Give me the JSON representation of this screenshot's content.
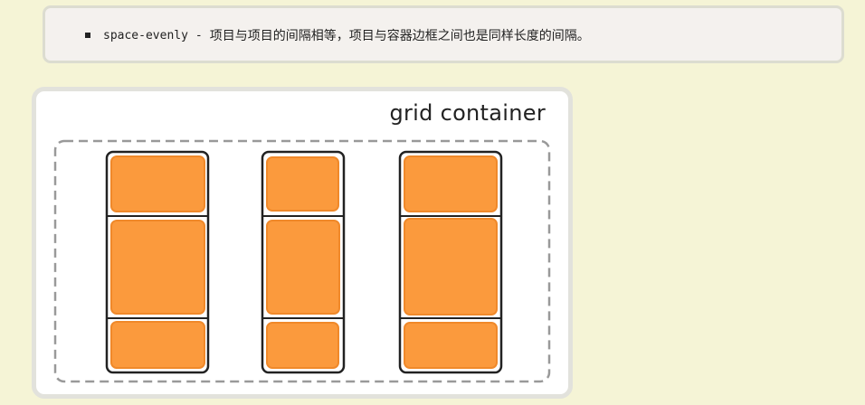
{
  "note": {
    "property": "space-evenly",
    "separator": "-",
    "description": "项目与项目的间隔相等，项目与容器边框之间也是同样长度的间隔。"
  },
  "figure": {
    "title": "grid container"
  },
  "colors": {
    "page_bg": "#f5f4d6",
    "item_fill": "#fb9a3d",
    "item_border": "#f0892a",
    "track_border": "#222222",
    "container_dash": "#999999"
  }
}
